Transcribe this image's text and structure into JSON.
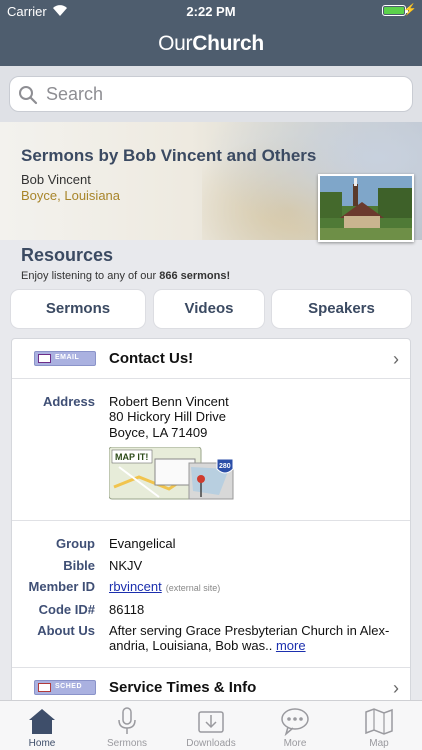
{
  "status": {
    "carrier": "Carrier",
    "time": "2:22 PM",
    "battery_level": 1.0
  },
  "app": {
    "title_light": "Our",
    "title_bold": "Church"
  },
  "search": {
    "placeholder": "Search"
  },
  "banner": {
    "title": "Sermons by Bob Vincent and Others",
    "name": "Bob Vincent",
    "location": "Boyce, Louisiana"
  },
  "resources": {
    "heading": "Resources",
    "subtitle_prefix": "Enjoy listening to any of our ",
    "sermon_count": "866 sermons!"
  },
  "buttons": {
    "sermons": "Sermons",
    "videos": "Videos",
    "speakers": "Speakers"
  },
  "contact": {
    "tag": "EMAIL",
    "label": "Contact Us!",
    "address_label": "Address",
    "address_lines": [
      "Robert Benn Vincent",
      "80 Hickory Hill Drive",
      "Boyce, LA 71409"
    ],
    "map_label": "MAP IT!",
    "map_route": "280"
  },
  "details": {
    "group_label": "Group",
    "group": "Evangelical",
    "bible_label": "Bible",
    "bible": "NKJV",
    "member_label": "Member ID",
    "member": "rbvincent",
    "member_note": "(external site)",
    "code_label": "Code ID#",
    "code": "86118",
    "about_label": "About Us",
    "about_line1": "After serving Grace Presbyterian Church in Alex-",
    "about_line2": "andria, Louisiana, Bob was.. ",
    "about_more": "more"
  },
  "service": {
    "tag": "SCHED",
    "label": "Service Times & Info"
  },
  "tabs": [
    {
      "label": "Home",
      "icon": "home-icon"
    },
    {
      "label": "Sermons",
      "icon": "microphone-icon"
    },
    {
      "label": "Downloads",
      "icon": "download-icon"
    },
    {
      "label": "More",
      "icon": "chat-bubble-icon"
    },
    {
      "label": "Map",
      "icon": "map-icon"
    }
  ]
}
